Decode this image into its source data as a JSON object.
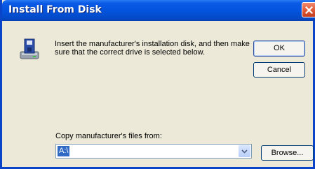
{
  "window": {
    "title": "Install From Disk",
    "close_icon": "close-icon"
  },
  "content": {
    "icon": "install-disk-icon",
    "message": "Insert the manufacturer's installation disk, and then make sure that the correct drive is selected below."
  },
  "buttons": {
    "ok_label": "OK",
    "cancel_label": "Cancel",
    "browse_label": "Browse..."
  },
  "copy_from": {
    "label": "Copy manufacturer's files from:",
    "value": "A:\\",
    "dropdown_icon": "chevron-down-icon"
  },
  "colors": {
    "titlebar": "#0453dc",
    "close_button": "#e05836",
    "dialog_background": "#ece9d8",
    "selection": "#316ac5"
  }
}
